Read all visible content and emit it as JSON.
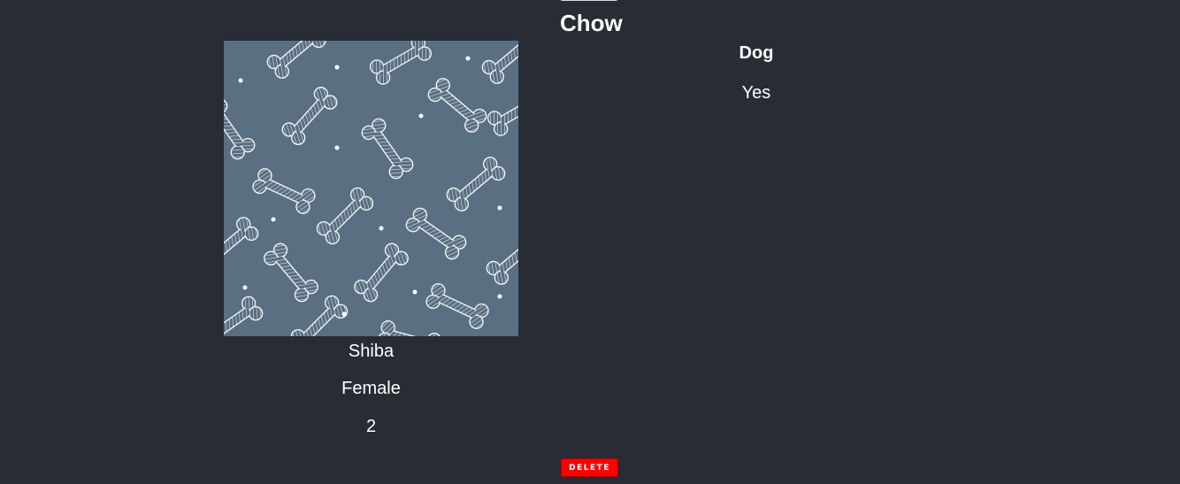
{
  "pet": {
    "name": "Chow",
    "species": "Dog",
    "status": "Yes",
    "breed": "Shiba",
    "gender": "Female",
    "age": "2"
  },
  "actions": {
    "delete_label": "DELETE"
  },
  "colors": {
    "background": "#282c34",
    "photo_background": "#5a6f81",
    "delete_button": "#ff0000",
    "text": "#ffffff"
  },
  "icons": {
    "photo_pattern": "dog-bone-pattern"
  }
}
